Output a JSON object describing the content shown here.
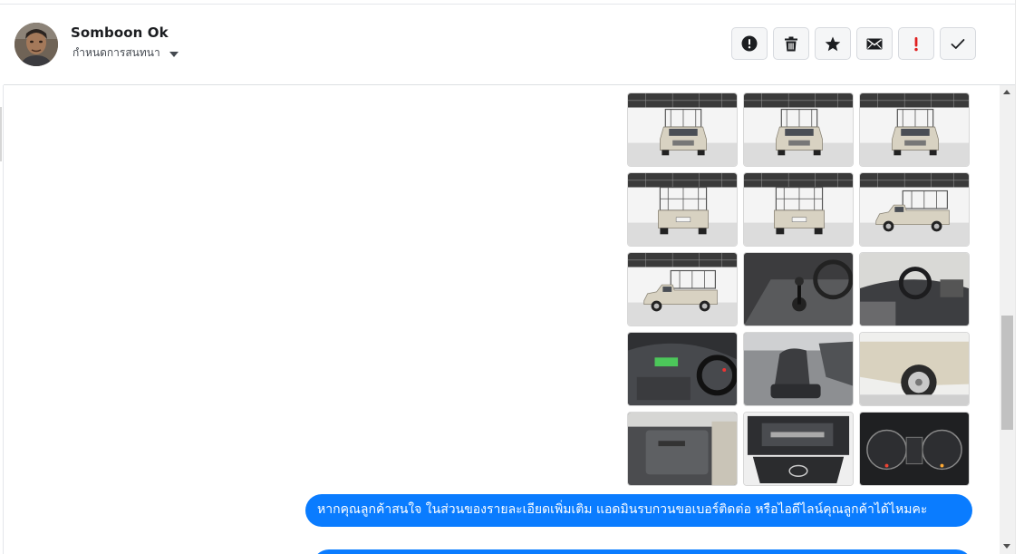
{
  "header": {
    "contact_name": "Somboon Ok",
    "assign_label": "กำหนดการสนทนา"
  },
  "toolbar": {
    "buttons": [
      {
        "name": "report-spam",
        "icon": "alert-circle-icon"
      },
      {
        "name": "delete",
        "icon": "trash-icon"
      },
      {
        "name": "star",
        "icon": "star-icon"
      },
      {
        "name": "mark-unread",
        "icon": "envelope-icon"
      },
      {
        "name": "follow-up",
        "icon": "exclamation-icon"
      },
      {
        "name": "mark-done",
        "icon": "checkmark-icon"
      }
    ]
  },
  "conversation": {
    "photos": [
      "pickup-front-left",
      "pickup-front",
      "pickup-front-right",
      "pickup-rear-left",
      "pickup-rear",
      "pickup-side-rear",
      "pickup-side",
      "interior-gearshift",
      "interior-dashboard",
      "dashboard-console",
      "passenger-seat",
      "front-wheel-closeup",
      "door-panel",
      "engine-bay",
      "instrument-cluster"
    ],
    "message_text": "หากคุณลูกค้าสนใจ ในส่วนของรายละเอียดเพิ่มเติม แอดมินรบกวนขอเบอร์ติดต่อ หรือไอดีไลน์คุณลูกค้าได้ไหมคะ"
  },
  "colors": {
    "bubble": "#0a7cff",
    "alert_icon": "#e02020",
    "icon_dark": "#1c1e21",
    "scroll_thumb": "#c1c1c1"
  }
}
